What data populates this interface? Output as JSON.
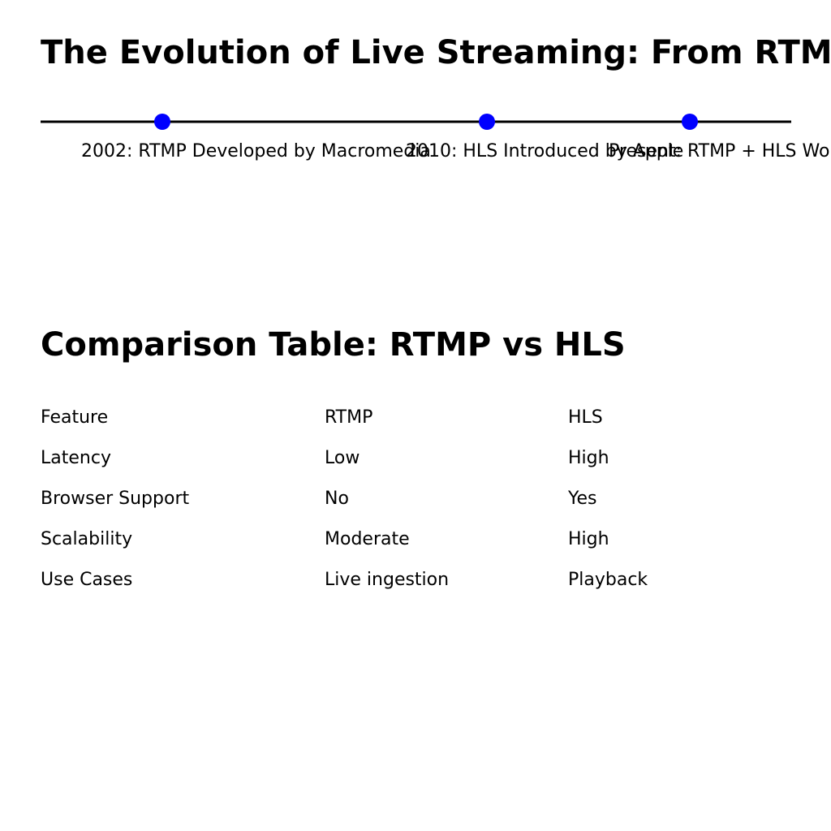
{
  "title": "The Evolution of Live Streaming: From RTMP to HLS",
  "timeline": {
    "line_color": "#000000",
    "marker_color": "#0000ff",
    "events": [
      {
        "label": "2002: RTMP Developed by Macromedia"
      },
      {
        "label": "2010: HLS Introduced by Apple"
      },
      {
        "label": "Present: RTMP + HLS Workflow"
      }
    ]
  },
  "comparison": {
    "title": "Comparison Table: RTMP vs HLS",
    "headers": [
      "Feature",
      "RTMP",
      "HLS"
    ],
    "rows": [
      [
        "Latency",
        "Low",
        "High"
      ],
      [
        "Browser Support",
        "No",
        "Yes"
      ],
      [
        "Scalability",
        "Moderate",
        "High"
      ],
      [
        "Use Cases",
        "Live ingestion",
        "Playback"
      ]
    ]
  }
}
